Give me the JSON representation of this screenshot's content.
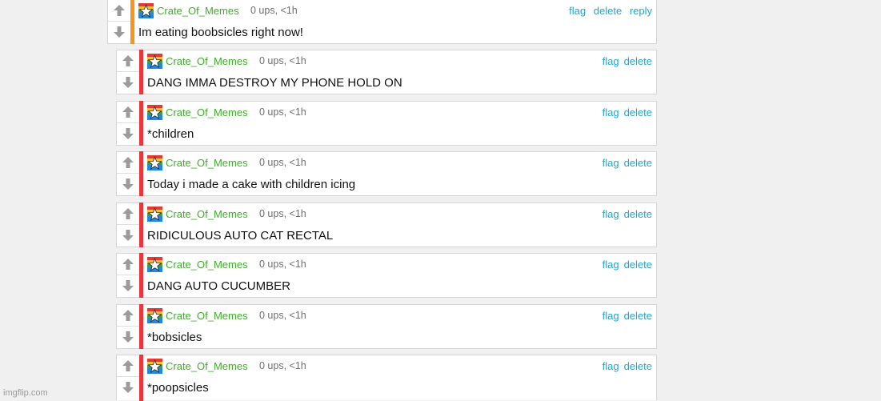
{
  "colors": {
    "top_bar": "#f7941d",
    "reply_bar": "#e8363c",
    "username": "#3fae2a",
    "action_link": "#1aa7d6"
  },
  "icons": {
    "up": "arrow-up-icon",
    "down": "arrow-down-icon",
    "avatar": "star-avatar-icon"
  },
  "top_comment": {
    "user": "Crate_Of_Memes",
    "meta": "0 ups, <1h",
    "text": "Im eating boobsicles right now!",
    "actions": {
      "flag": "flag",
      "delete": "delete",
      "reply": "reply"
    }
  },
  "replies": [
    {
      "user": "Crate_Of_Memes",
      "meta": "0 ups, <1h",
      "text": "DANG IMMA DESTROY MY PHONE HOLD ON",
      "flag": "flag",
      "delete": "delete"
    },
    {
      "user": "Crate_Of_Memes",
      "meta": "0 ups, <1h",
      "text": "*children",
      "flag": "flag",
      "delete": "delete"
    },
    {
      "user": "Crate_Of_Memes",
      "meta": "0 ups, <1h",
      "text": "Today i made a cake with children icing",
      "flag": "flag",
      "delete": "delete"
    },
    {
      "user": "Crate_Of_Memes",
      "meta": "0 ups, <1h",
      "text": "RIDICULOUS AUTO CAT RECTAL",
      "flag": "flag",
      "delete": "delete"
    },
    {
      "user": "Crate_Of_Memes",
      "meta": "0 ups, <1h",
      "text": "DANG AUTO CUCUMBER",
      "flag": "flag",
      "delete": "delete"
    },
    {
      "user": "Crate_Of_Memes",
      "meta": "0 ups, <1h",
      "text": "*bobsicles",
      "flag": "flag",
      "delete": "delete"
    },
    {
      "user": "Crate_Of_Memes",
      "meta": "0 ups, <1h",
      "text": "*poopsicles",
      "flag": "flag",
      "delete": "delete"
    }
  ],
  "watermark": "imgflip.com"
}
